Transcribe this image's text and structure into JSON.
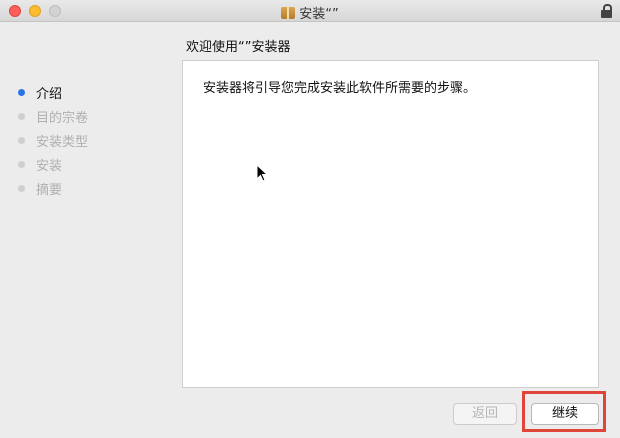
{
  "window": {
    "title": "安装“”"
  },
  "page": {
    "heading": "欢迎使用“”安装器"
  },
  "steps": [
    {
      "label": "介绍",
      "active": true
    },
    {
      "label": "目的宗卷",
      "active": false
    },
    {
      "label": "安装类型",
      "active": false
    },
    {
      "label": "安装",
      "active": false
    },
    {
      "label": "摘要",
      "active": false
    }
  ],
  "content": {
    "text": "安装器将引导您完成安装此软件所需要的步骤。"
  },
  "buttons": {
    "back_label": "返回",
    "continue_label": "继续"
  },
  "colors": {
    "active_step_dot": "#2a73e8",
    "highlight": "#e0453a"
  }
}
